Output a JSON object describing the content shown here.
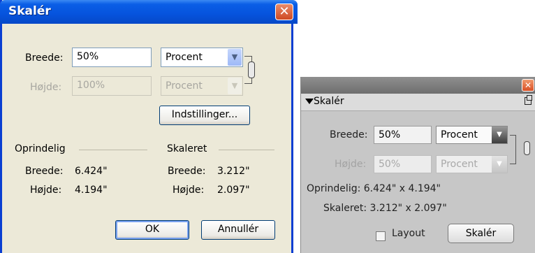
{
  "dialog": {
    "title": "Skalér",
    "close_glyph": "✕",
    "width_label": "Breede:",
    "width_value": "50%",
    "width_unit": "Procent",
    "height_label": "Højde:",
    "height_value": "100%",
    "height_unit": "Procent",
    "settings_button": "Indstillinger...",
    "original_header": "Oprindelig",
    "scaled_header": "Skaleret",
    "orig_width_label": "Breede:",
    "orig_width_value": "6.424\"",
    "orig_height_label": "Højde:",
    "orig_height_value": "4.194\"",
    "scaled_width_label": "Breede:",
    "scaled_width_value": "3.212\"",
    "scaled_height_label": "Højde:",
    "scaled_height_value": "2.097\"",
    "ok_button": "OK",
    "cancel_button": "Annullér"
  },
  "panel": {
    "close_glyph": "✕",
    "title": "Skalér",
    "width_label": "Breede:",
    "width_value": "50%",
    "width_unit": "Procent",
    "height_label": "Højde:",
    "height_value": "50%",
    "height_unit": "Procent",
    "original_text": "Oprindelig: 6.424\" x 4.194\"",
    "scaled_text": "Skaleret: 3.212\" x 2.097\"",
    "layout_label": "Layout",
    "layout_checked": false,
    "scale_button": "Skalér"
  },
  "icons": {
    "dropdown_arrow": "chevron-down-icon",
    "link": "chain-link-icon",
    "collapse": "triangle-down-icon",
    "undock": "undock-icon",
    "close": "close-icon"
  }
}
